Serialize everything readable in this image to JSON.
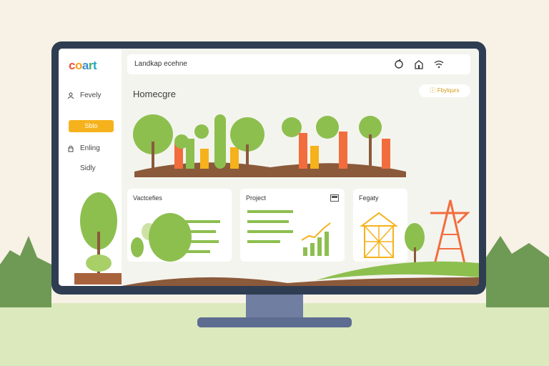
{
  "logo": {
    "letters": [
      "c",
      "o",
      "a",
      "r",
      "t"
    ],
    "colors": [
      "#f04e3b",
      "#f6a21d",
      "#3d8cd6",
      "#40b06a",
      "#26a3c2"
    ]
  },
  "sidebar": {
    "items": [
      {
        "label": "Fevely",
        "icon": "person-icon"
      },
      {
        "label": "Sblo",
        "active": true
      },
      {
        "label": "Enling",
        "icon": "lock-icon"
      },
      {
        "label": "Sidly"
      }
    ]
  },
  "search": {
    "value": "Landkap ecehne"
  },
  "topbar": {
    "icons": [
      "refresh-icon",
      "home-icon",
      "wifi-icon"
    ]
  },
  "page": {
    "title": "Homecgre"
  },
  "pill": {
    "label": "Fbylqurs",
    "icon": "info-icon"
  },
  "cards": [
    {
      "title": "Vactcefies"
    },
    {
      "title": "Project",
      "icon": "image-icon"
    },
    {
      "title": "Fegaty"
    }
  ],
  "colors": {
    "green": "#8dbf4f",
    "orange": "#f26d3d",
    "yellow": "#f6b21c",
    "monitor": "#2f3d52"
  }
}
